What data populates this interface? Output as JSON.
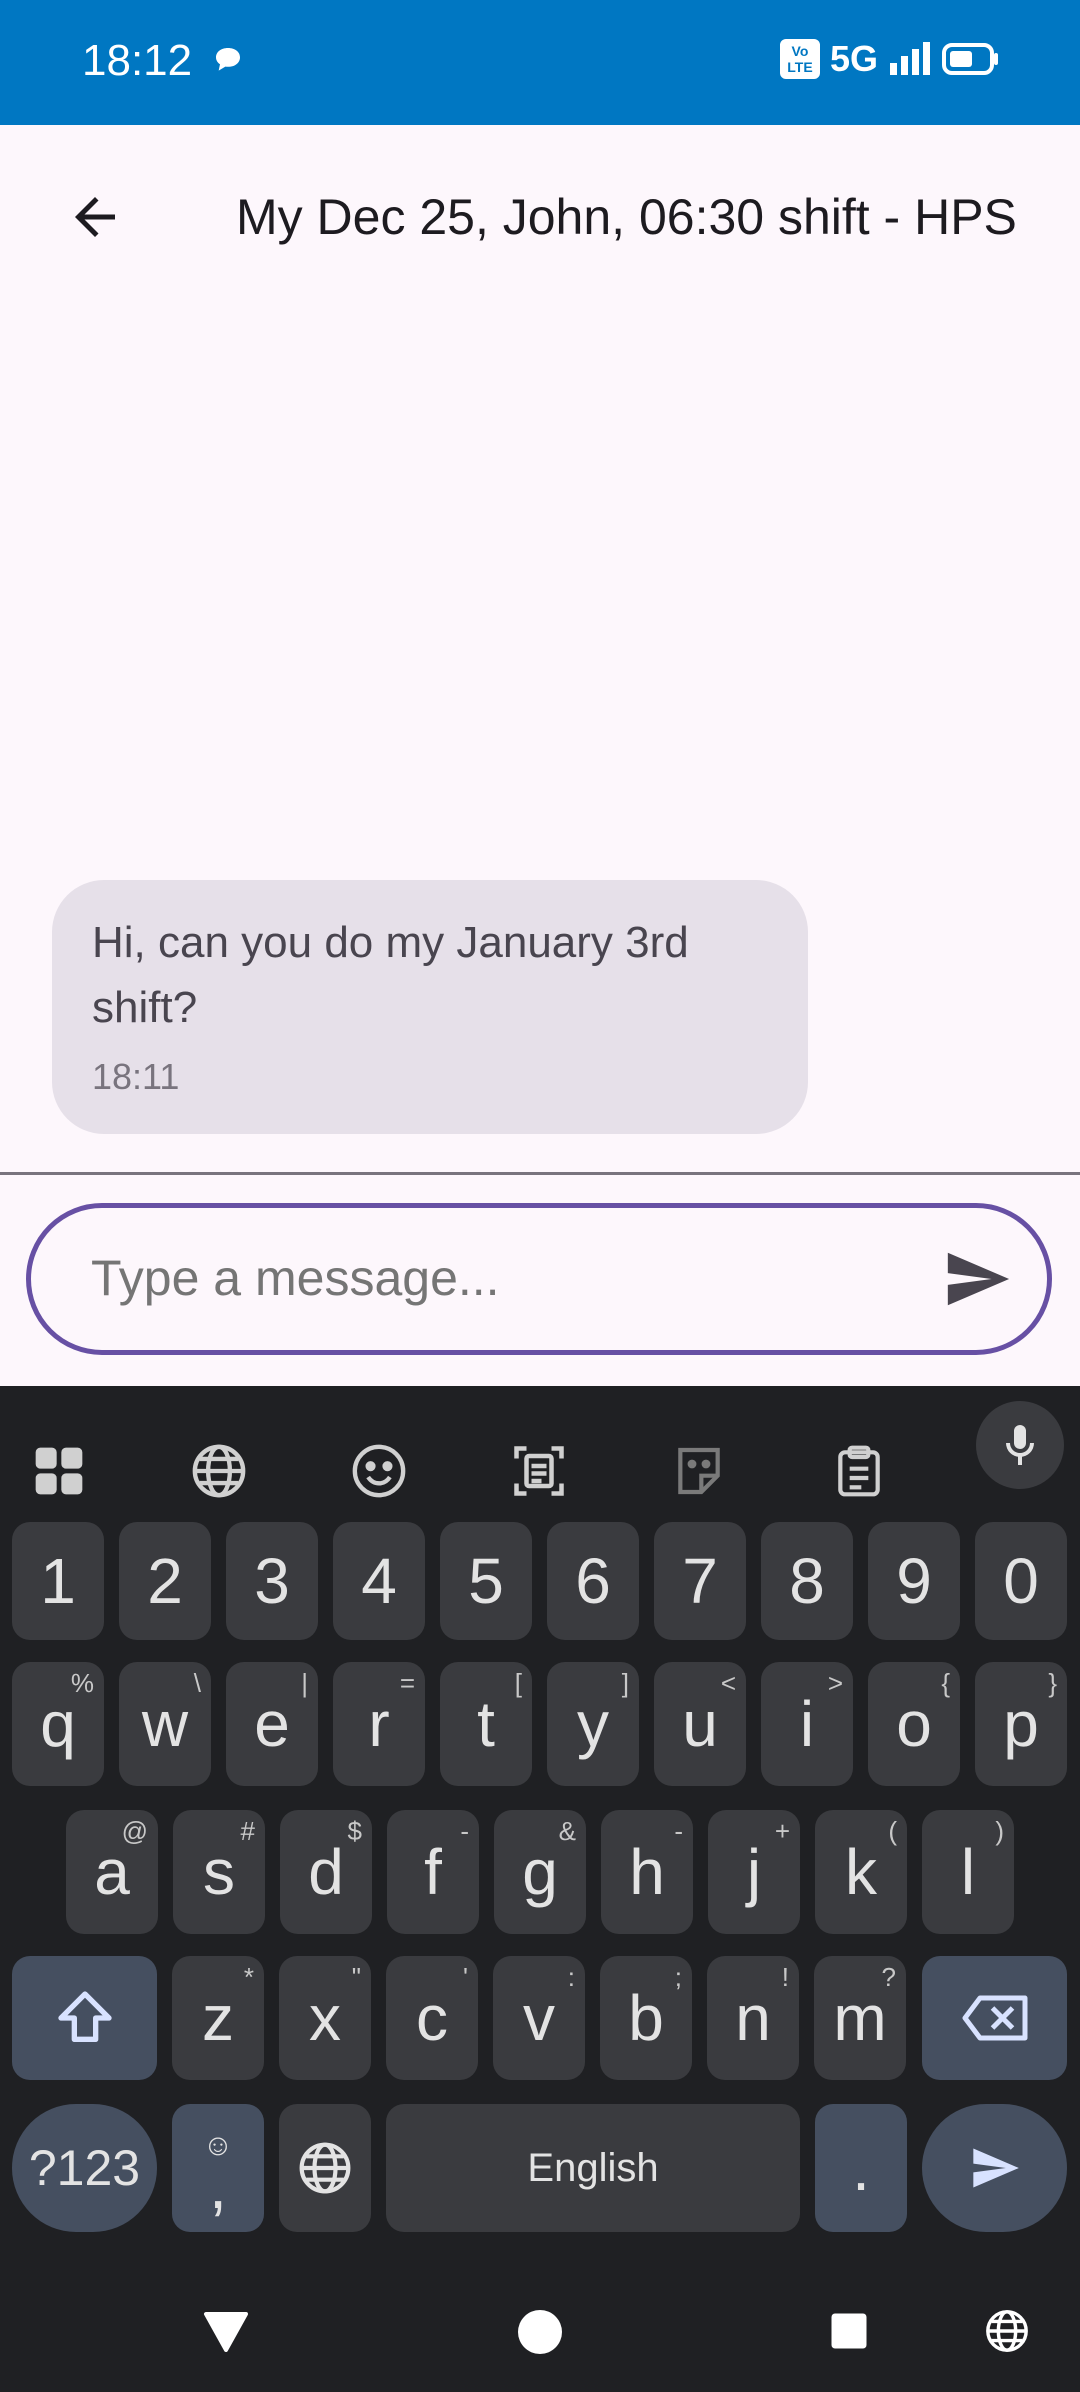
{
  "status_bar": {
    "time": "18:12",
    "network": "5G",
    "volte": "Vo LTE"
  },
  "header": {
    "title": "My Dec 25, John, 06:30 shift - HPS"
  },
  "messages": [
    {
      "text": "Hi, can you do my January 3rd shift?",
      "time": "18:11"
    }
  ],
  "composer": {
    "placeholder": "Type a message..."
  },
  "keyboard": {
    "row_numbers": [
      "1",
      "2",
      "3",
      "4",
      "5",
      "6",
      "7",
      "8",
      "9",
      "0"
    ],
    "row_q": [
      {
        "k": "q",
        "h": "%"
      },
      {
        "k": "w",
        "h": "\\"
      },
      {
        "k": "e",
        "h": "|"
      },
      {
        "k": "r",
        "h": "="
      },
      {
        "k": "t",
        "h": "["
      },
      {
        "k": "y",
        "h": "]"
      },
      {
        "k": "u",
        "h": "<"
      },
      {
        "k": "i",
        "h": ">"
      },
      {
        "k": "o",
        "h": "{"
      },
      {
        "k": "p",
        "h": "}"
      }
    ],
    "row_a": [
      {
        "k": "a",
        "h": "@"
      },
      {
        "k": "s",
        "h": "#"
      },
      {
        "k": "d",
        "h": "$"
      },
      {
        "k": "f",
        "h": "-"
      },
      {
        "k": "g",
        "h": "&"
      },
      {
        "k": "h",
        "h": "-"
      },
      {
        "k": "j",
        "h": "+"
      },
      {
        "k": "k",
        "h": "("
      },
      {
        "k": "l",
        "h": ")"
      }
    ],
    "row_z": [
      {
        "k": "z",
        "h": "*"
      },
      {
        "k": "x",
        "h": "\""
      },
      {
        "k": "c",
        "h": "'"
      },
      {
        "k": "v",
        "h": ":"
      },
      {
        "k": "b",
        "h": ";"
      },
      {
        "k": "n",
        "h": "!"
      },
      {
        "k": "m",
        "h": "?"
      }
    ],
    "symbols_label": "?123",
    "comma_key": ",",
    "comma_hint": "☺",
    "space_label": "English",
    "period_key": "."
  }
}
